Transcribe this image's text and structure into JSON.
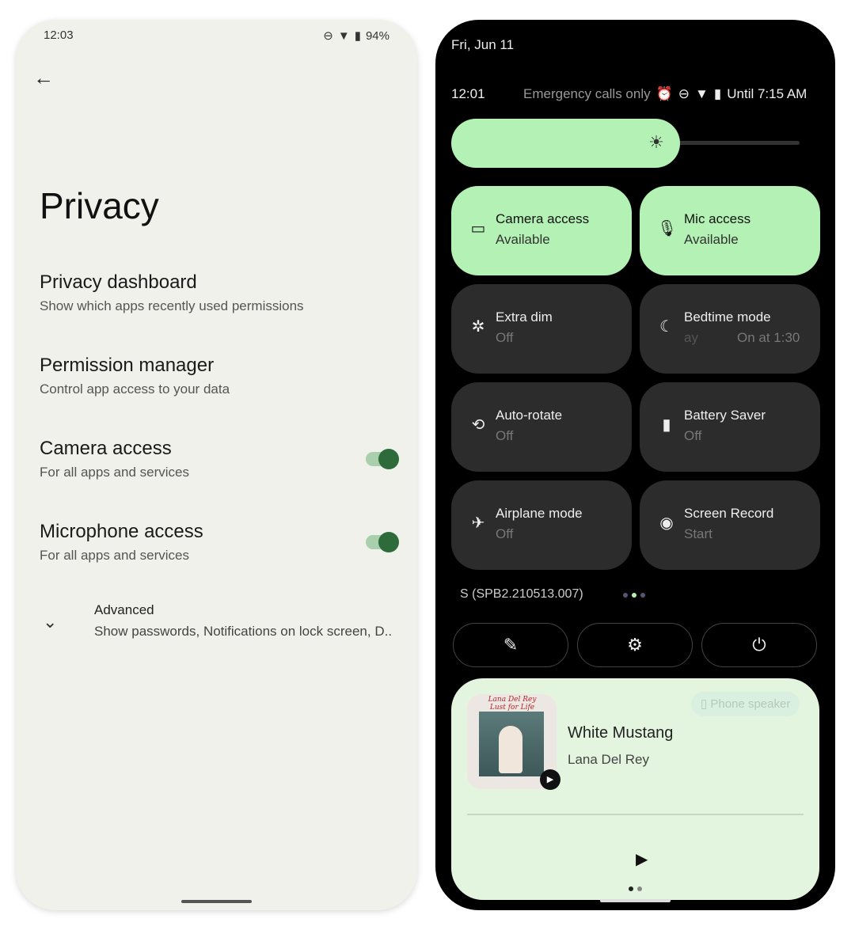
{
  "settings": {
    "status_time": "12:03",
    "battery": "94%",
    "title": "Privacy",
    "items": [
      {
        "title": "Privacy dashboard",
        "subtitle": "Show which apps recently used permissions"
      },
      {
        "title": "Permission manager",
        "subtitle": "Control app access to your data"
      },
      {
        "title": "Camera access",
        "subtitle": "For all apps and services",
        "toggle": true
      },
      {
        "title": "Microphone access",
        "subtitle": "For all apps and services",
        "toggle": true
      }
    ],
    "advanced": {
      "title": "Advanced",
      "subtitle": "Show passwords, Notifications on lock screen, D.."
    }
  },
  "qs": {
    "date": "Fri, Jun 11",
    "time": "12:01",
    "carrier": "Emergency calls only",
    "battery_text": "Until 7:15 AM",
    "brightness": 0.6,
    "accent": "#b3f1b4",
    "tiles": [
      {
        "label": "Camera access",
        "state": "Available",
        "icon": "camera-icon",
        "on": true
      },
      {
        "label": "Mic access",
        "state": "Available",
        "icon": "mic-icon",
        "on": true
      },
      {
        "label": "Extra dim",
        "state": "Off",
        "icon": "extra-dim-icon"
      },
      {
        "label": "Bedtime mode",
        "state_left": "ay",
        "state": "On at 1:30",
        "icon": "bedtime-icon"
      },
      {
        "label": "Auto-rotate",
        "state": "Off",
        "icon": "rotate-icon"
      },
      {
        "label": "Battery Saver",
        "state": "Off",
        "icon": "battery-saver-icon"
      },
      {
        "label": "Airplane mode",
        "state": "Off",
        "icon": "airplane-icon"
      },
      {
        "label": "Screen Record",
        "state": "Start",
        "icon": "screen-record-icon"
      }
    ],
    "build": "S (SPB2.210513.007)",
    "media": {
      "title": "White Mustang",
      "artist": "Lana Del Rey",
      "output": "Phone speaker",
      "album_text": "Lana Del Rey Lust for Life"
    }
  }
}
